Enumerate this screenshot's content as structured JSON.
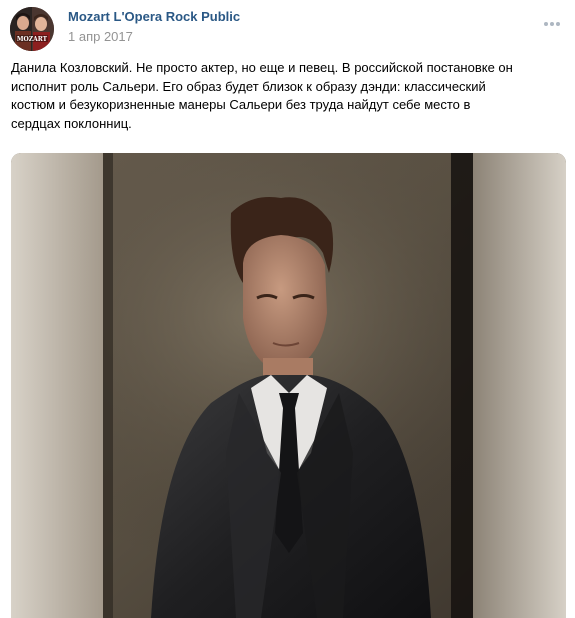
{
  "post": {
    "author": "Mozart L'Opera Rock Public",
    "date": "1 апр 2017",
    "text_lines": [
      "Данила Козловский. Не просто актер, но еще и певец. В российской постановке он",
      "исполнит роль Сальери. Его образ будет близок к образу дэнди: классический",
      "костюм и безукоризненные манеры Сальери без труда найдут себе место в",
      "сердцах поклонниц."
    ],
    "avatar_text": "MOZART"
  },
  "colors": {
    "author_link": "#2a5885",
    "date_text": "#939393",
    "more_dots": "#aeb7c2"
  },
  "icons": {
    "more": "more-dots-icon"
  }
}
